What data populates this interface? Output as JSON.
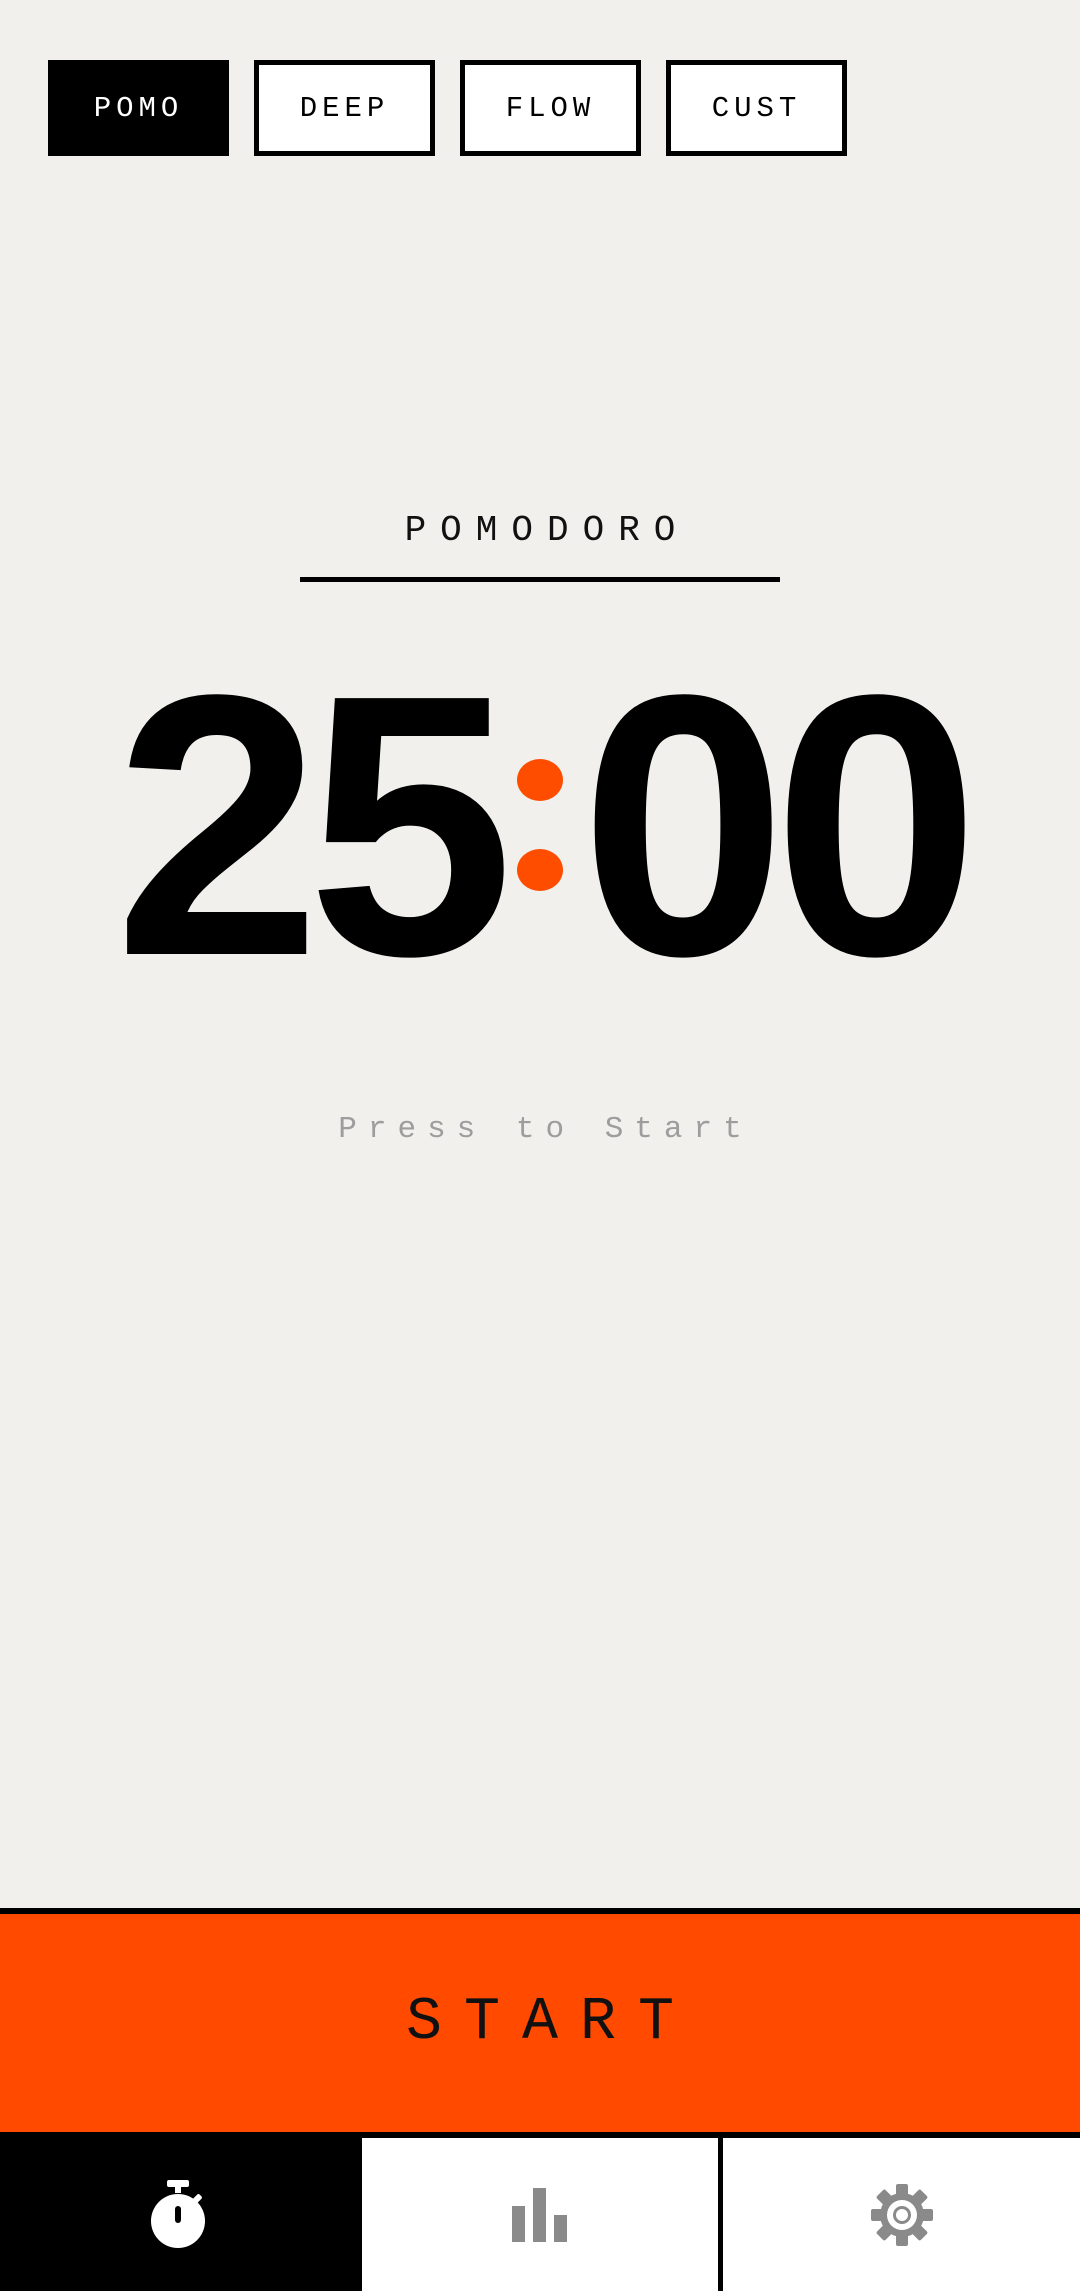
{
  "modes": [
    {
      "label": "POMO",
      "active": true
    },
    {
      "label": "DEEP",
      "active": false
    },
    {
      "label": "FLOW",
      "active": false
    },
    {
      "label": "CUST",
      "active": false
    }
  ],
  "session": {
    "label": "POMODORO"
  },
  "timer": {
    "minutes": "25",
    "seconds": "00"
  },
  "hint": "Press to Start",
  "start_button": {
    "label": "START"
  },
  "tabbar": [
    {
      "icon": "stopwatch-icon",
      "active": true
    },
    {
      "icon": "bar-chart-icon",
      "active": false
    },
    {
      "icon": "gear-icon",
      "active": false
    }
  ],
  "colors": {
    "background": "#f1f0ed",
    "accent": "#ff4a00",
    "ink": "#000000",
    "muted": "#9d9d9d"
  }
}
